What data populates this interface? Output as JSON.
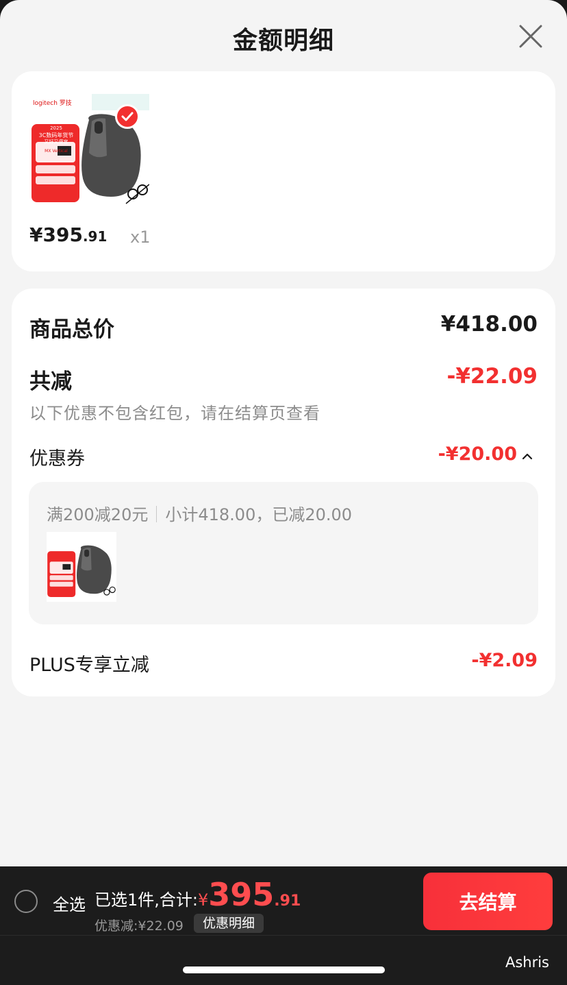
{
  "sheet": {
    "title": "金额明细"
  },
  "product": {
    "price_int": "¥395",
    "price_dec": ".91",
    "quantity": "x1",
    "thumb_brand": "logitech 罗技",
    "thumb_event": "3C数码年货节",
    "thumb_year": "2025",
    "thumb_sub": "又好又便宜",
    "thumb_model": "MX Vertical",
    "selected": true
  },
  "summary": {
    "total_label": "商品总价",
    "total_value": "¥418.00",
    "discount_label": "共减",
    "discount_value": "-¥22.09",
    "note": "以下优惠不包含红包，请在结算页查看",
    "coupon_label": "优惠券",
    "coupon_value": "-¥20.00",
    "coupon_rule": "满200减20元",
    "coupon_detail": "小计418.00，已减20.00",
    "plus_label": "PLUS专享立减",
    "plus_value": "-¥2.09"
  },
  "bottom_bar": {
    "select_all": "全选",
    "selected_text": "已选1件,合计:",
    "currency": "¥",
    "total_int": "395",
    "total_dec": ".91",
    "discount_text": "优惠减:¥22.09",
    "detail_button": "优惠明细",
    "checkout_button": "去结算",
    "username": "Ashris"
  },
  "colors": {
    "accent_red": "#f23030",
    "checkout_red": "#f7303a",
    "bar_bg": "#1c1c1c",
    "sheet_bg": "#f4f4f4"
  }
}
